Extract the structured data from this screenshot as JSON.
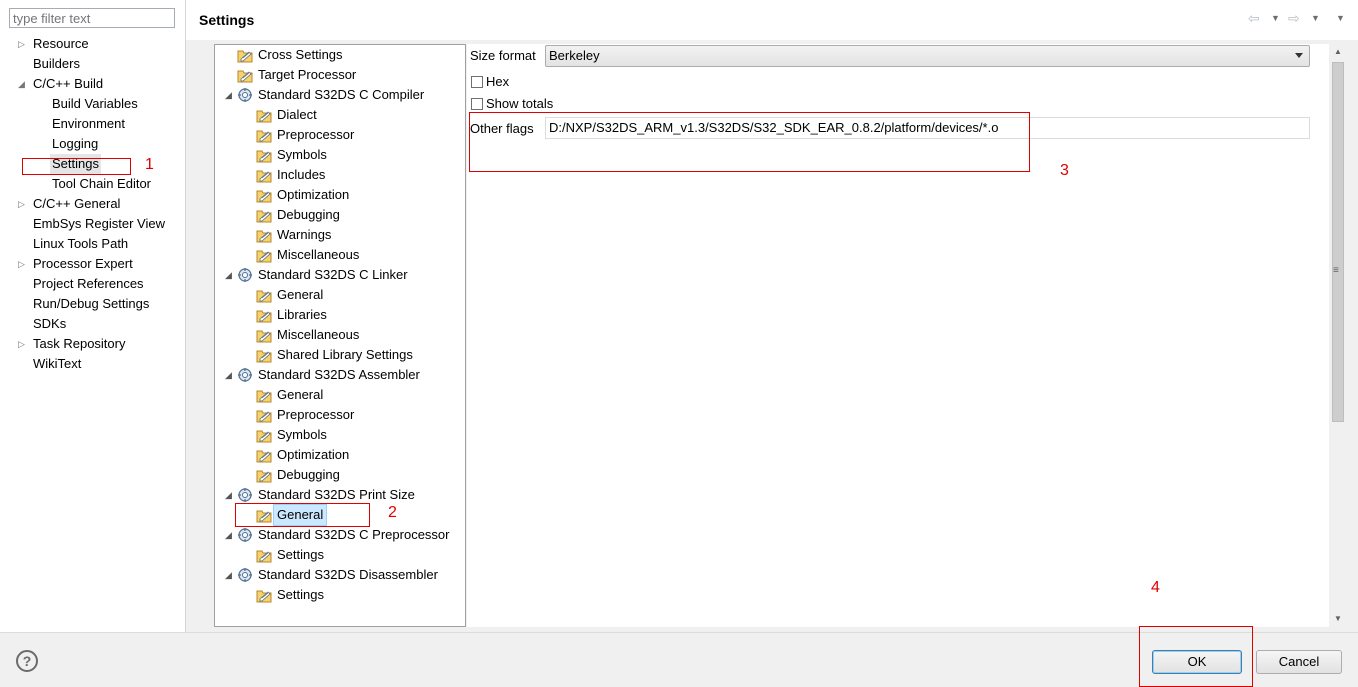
{
  "filter": {
    "placeholder": "type filter text"
  },
  "nav": {
    "items": [
      {
        "label": "Resource",
        "arrow": "▷"
      },
      {
        "label": "Builders",
        "arrow": ""
      },
      {
        "label": "C/C++ Build",
        "arrow": "◢"
      },
      {
        "label": "Build Variables",
        "arrow": ""
      },
      {
        "label": "Environment",
        "arrow": ""
      },
      {
        "label": "Logging",
        "arrow": ""
      },
      {
        "label": "Settings",
        "arrow": "",
        "selected": true
      },
      {
        "label": "Tool Chain Editor",
        "arrow": ""
      },
      {
        "label": "C/C++ General",
        "arrow": "▷"
      },
      {
        "label": "EmbSys Register View",
        "arrow": ""
      },
      {
        "label": "Linux Tools Path",
        "arrow": ""
      },
      {
        "label": "Processor Expert",
        "arrow": "▷"
      },
      {
        "label": "Project References",
        "arrow": ""
      },
      {
        "label": "Run/Debug Settings",
        "arrow": ""
      },
      {
        "label": "SDKs",
        "arrow": ""
      },
      {
        "label": "Task Repository",
        "arrow": "▷"
      },
      {
        "label": "WikiText",
        "arrow": ""
      }
    ]
  },
  "header": {
    "title": "Settings",
    "back_icon": "back-arrow-icon",
    "forward_icon": "forward-arrow-icon",
    "back_glyph": "⇦",
    "forward_glyph": "⇨",
    "drop_glyph": "▼"
  },
  "tree": {
    "items": [
      {
        "label": "Cross Settings",
        "type": "page",
        "arrow": ""
      },
      {
        "label": "Target Processor",
        "type": "page",
        "arrow": ""
      },
      {
        "label": "Standard S32DS C Compiler",
        "type": "tool",
        "arrow": "◢"
      },
      {
        "label": "Dialect",
        "type": "page",
        "arrow": ""
      },
      {
        "label": "Preprocessor",
        "type": "page",
        "arrow": ""
      },
      {
        "label": "Symbols",
        "type": "page",
        "arrow": ""
      },
      {
        "label": "Includes",
        "type": "page",
        "arrow": ""
      },
      {
        "label": "Optimization",
        "type": "page",
        "arrow": ""
      },
      {
        "label": "Debugging",
        "type": "page",
        "arrow": ""
      },
      {
        "label": "Warnings",
        "type": "page",
        "arrow": ""
      },
      {
        "label": "Miscellaneous",
        "type": "page",
        "arrow": ""
      },
      {
        "label": "Standard S32DS C Linker",
        "type": "tool",
        "arrow": "◢"
      },
      {
        "label": "General",
        "type": "page",
        "arrow": ""
      },
      {
        "label": "Libraries",
        "type": "page",
        "arrow": ""
      },
      {
        "label": "Miscellaneous",
        "type": "page",
        "arrow": ""
      },
      {
        "label": "Shared Library Settings",
        "type": "page",
        "arrow": ""
      },
      {
        "label": "Standard S32DS Assembler",
        "type": "tool",
        "arrow": "◢"
      },
      {
        "label": "General",
        "type": "page",
        "arrow": ""
      },
      {
        "label": "Preprocessor",
        "type": "page",
        "arrow": ""
      },
      {
        "label": "Symbols",
        "type": "page",
        "arrow": ""
      },
      {
        "label": "Optimization",
        "type": "page",
        "arrow": ""
      },
      {
        "label": "Debugging",
        "type": "page",
        "arrow": ""
      },
      {
        "label": "Standard S32DS Print Size",
        "type": "tool",
        "arrow": "◢"
      },
      {
        "label": "General",
        "type": "page",
        "arrow": "",
        "selected": true
      },
      {
        "label": "Standard S32DS C Preprocessor",
        "type": "tool",
        "arrow": "◢"
      },
      {
        "label": "Settings",
        "type": "page",
        "arrow": ""
      },
      {
        "label": "Standard S32DS Disassembler",
        "type": "tool",
        "arrow": "◢"
      },
      {
        "label": "Settings",
        "type": "page",
        "arrow": ""
      }
    ]
  },
  "form": {
    "size_format_label": "Size format",
    "size_format_value": "Berkeley",
    "hex_label": "Hex",
    "hex_checked": false,
    "show_totals_label": "Show totals",
    "show_totals_checked": false,
    "other_flags_label": "Other flags",
    "other_flags_value": "D:/NXP/S32DS_ARM_v1.3/S32DS/S32_SDK_EAR_0.8.2/platform/devices/*.o"
  },
  "footer": {
    "help_glyph": "?",
    "ok_label": "OK",
    "cancel_label": "Cancel"
  },
  "annotations": [
    "1",
    "2",
    "3",
    "4"
  ],
  "colors": {
    "annotation": "#e00000",
    "selection": "#cce8ff",
    "ok_border": "#3c7fb1"
  }
}
